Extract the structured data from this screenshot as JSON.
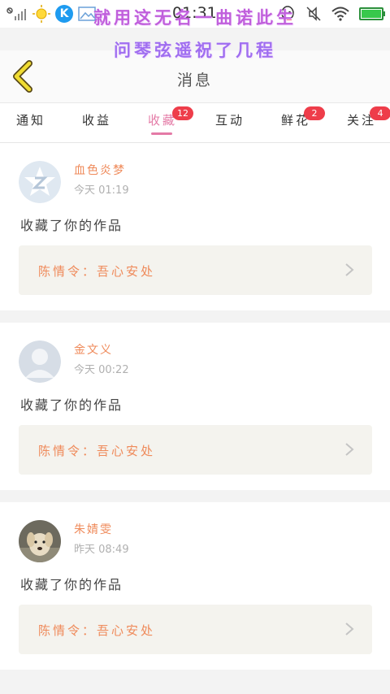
{
  "status_bar": {
    "time": "01:31",
    "app_icon_letter": "K",
    "icons": [
      "signal-off-icon",
      "sun-icon",
      "kugou-app-icon",
      "image-icon",
      "qq-icon",
      "mute-icon",
      "wifi-icon",
      "battery-icon"
    ]
  },
  "overlay": {
    "line1": "就用这无名一曲诺此生",
    "line2": "问琴弦遥祝了几程"
  },
  "header": {
    "title": "消息",
    "back_icon": "chevron-left-icon",
    "accent_color": "#f0dc32"
  },
  "tabs": [
    {
      "label": "通知",
      "badge": ""
    },
    {
      "label": "收益",
      "badge": ""
    },
    {
      "label": "收藏",
      "badge": "12",
      "active": true
    },
    {
      "label": "互动",
      "badge": ""
    },
    {
      "label": "鲜花",
      "badge": "2"
    },
    {
      "label": "关注",
      "badge": "4"
    }
  ],
  "messages": [
    {
      "name": "血色炎梦",
      "time": "今天 01:19",
      "action": "收藏了你的作品",
      "work": "陈情令：吾心安处",
      "avatar": "qq-default-avatar"
    },
    {
      "name": "金文义",
      "time": "今天 00:22",
      "action": "收藏了你的作品",
      "work": "陈情令：吾心安处",
      "avatar": "default-person-avatar"
    },
    {
      "name": "朱婧雯",
      "time": "昨天 08:49",
      "action": "收藏了你的作品",
      "work": "陈情令：吾心安处",
      "avatar": "dog-photo-avatar"
    }
  ],
  "colors": {
    "accent_pink": "#e47aa6",
    "name_orange": "#ef8a5a",
    "badge_red": "#ee3d4a"
  }
}
